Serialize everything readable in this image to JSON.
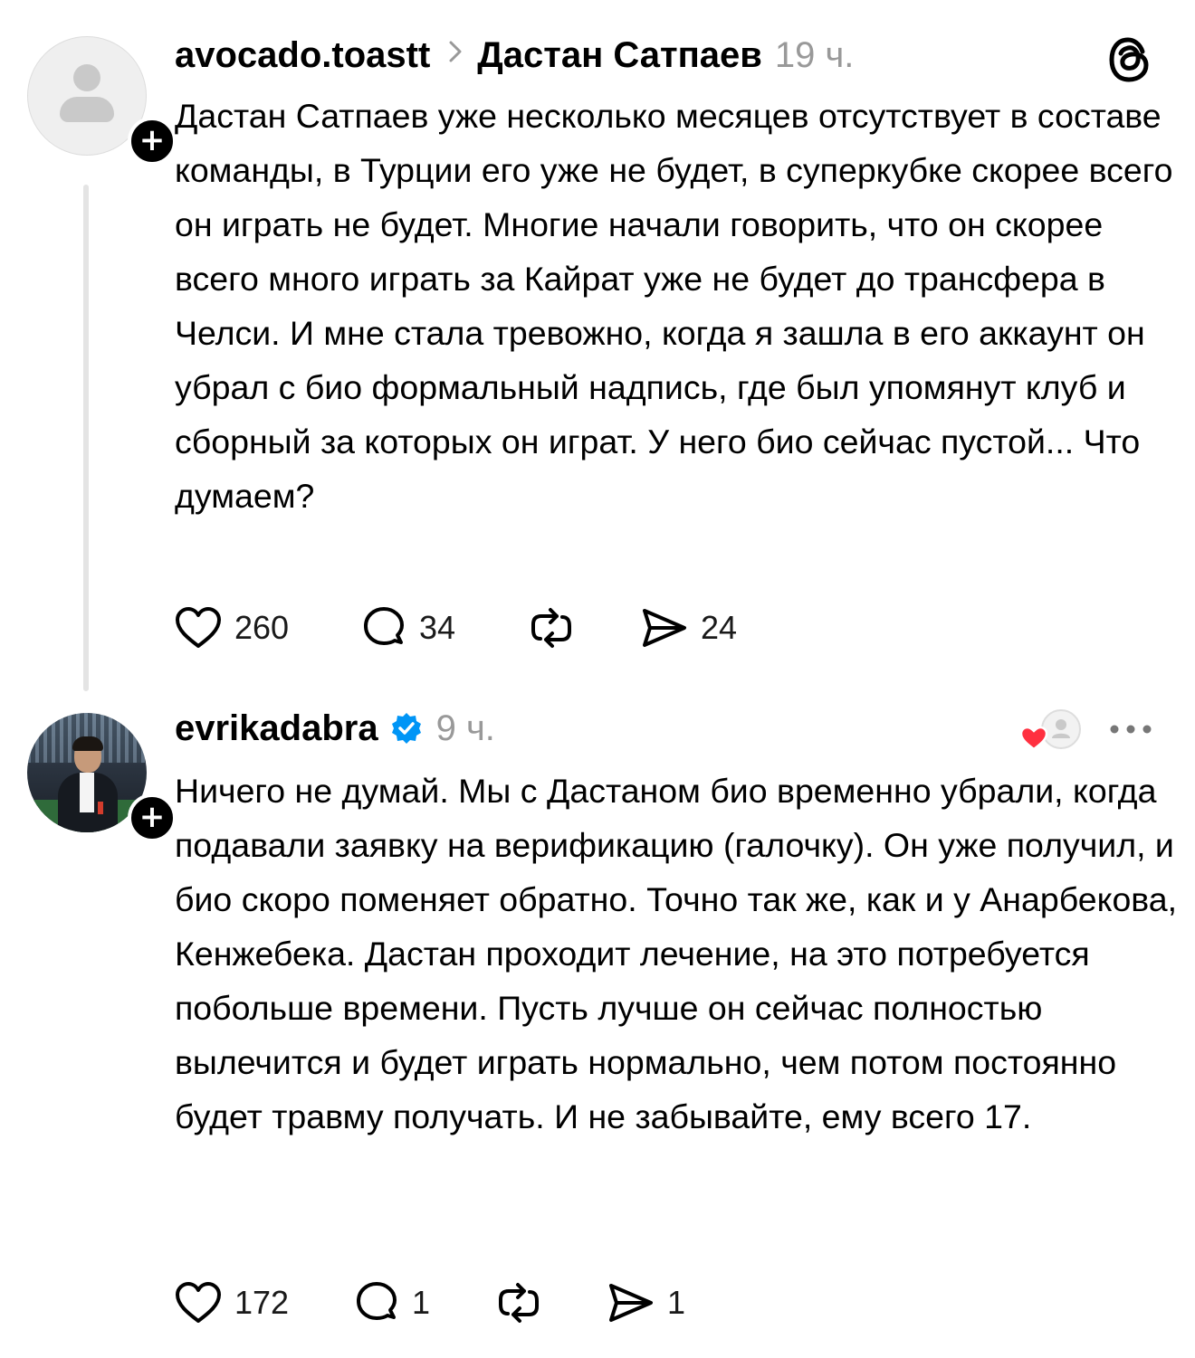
{
  "posts": [
    {
      "username": "avocado.toastt",
      "reply_to": "Дастан Сатпаев",
      "time": "19 ч.",
      "text": "Дастан Сатпаев уже несколько месяцев отсутствует в составе команды, в Турции его уже не будет, в суперкубке скорее всего он играть не будет. Многие начали говорить, что он скорее всего много играть за Кайрат уже не будет до трансфера в Челси. И мне стала тревожно, когда я зашла в его аккаунт он убрал с био формальный надпись, где был упомянут клуб и сборный за которых он играт. У него био сейчас пустой... Что думаем?",
      "likes": "260",
      "comments": "34",
      "shares": "24"
    },
    {
      "username": "evrikadabra",
      "verified": true,
      "time": "9 ч.",
      "text": "Ничего не думай. Мы с Дастаном био временно убрали, когда подавали заявку на верификацию (галочку). Он уже получил, и био скоро поменяет обратно. Точно так же, как и у Анарбекова, Кенжебека. Дастан проходит лечение, на это потребуется побольше времени. Пусть лучше он сейчас полностью вылечится и будет играть нормально, чем потом постоянно будет травму получать. И не забывайте, ему всего 17.",
      "likes": "172",
      "comments": "1",
      "shares": "1"
    }
  ],
  "icons": {
    "header_right": "threads-logo-icon",
    "liked_by_author": "heart-avatar-icon",
    "more": "more-dots-icon"
  },
  "colors": {
    "verified": "#0095f6",
    "like_red": "#ff3040",
    "secondary_text": "#999999"
  }
}
